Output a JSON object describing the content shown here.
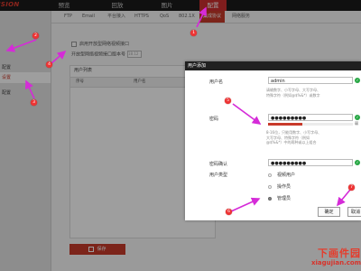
{
  "app": {
    "brand": "ISION"
  },
  "topnav": [
    "预览",
    "回放",
    "图片",
    "配置"
  ],
  "sidebar": [
    "配置",
    "设置",
    "配置"
  ],
  "tabs": [
    "FTP",
    "Email",
    "平台接入",
    "HTTPS",
    "QoS",
    "802.1X",
    "集成协议",
    "网络服务"
  ],
  "main": {
    "check_label": "启用开放型网络视频接口",
    "number_label": "开放型网络视频接口版本号",
    "number_value": "18.12"
  },
  "user_list": {
    "title": "用户列表",
    "columns": [
      "序号",
      "用户名"
    ]
  },
  "save_label": "保存",
  "dialog": {
    "title": "用户添加",
    "username_label": "用户名",
    "username_value": "admin",
    "username_hint": "请输数字、小写字母、大写字母、特殊字符（例如@$%&*）或数字",
    "password_label": "密码",
    "password_value": "●●●●●●●●●",
    "password_hint": "8-16位，只能用数字、小写字母、大写字母、特殊字符（例如@$%&*）中的两种或以上组合",
    "strength_label": "弱",
    "strength": 0.4,
    "confirm_label": "密码确认",
    "confirm_value": "●●●●●●●●●",
    "type_label": "用户类型",
    "types": [
      "视频用户",
      "操作员",
      "管理员"
    ],
    "selected_type": "管理员",
    "ok_label": "确定",
    "cancel_label": "取消"
  },
  "markers": [
    "1",
    "2",
    "3",
    "4",
    "5",
    "6",
    "7"
  ],
  "watermark": {
    "cn": "下画件园",
    "en": "xiagujian.com"
  },
  "colors": {
    "accent": "#c83a2b",
    "marker": "#ee3434",
    "ok": "#28a745",
    "topbar": "#1b1b1b"
  }
}
